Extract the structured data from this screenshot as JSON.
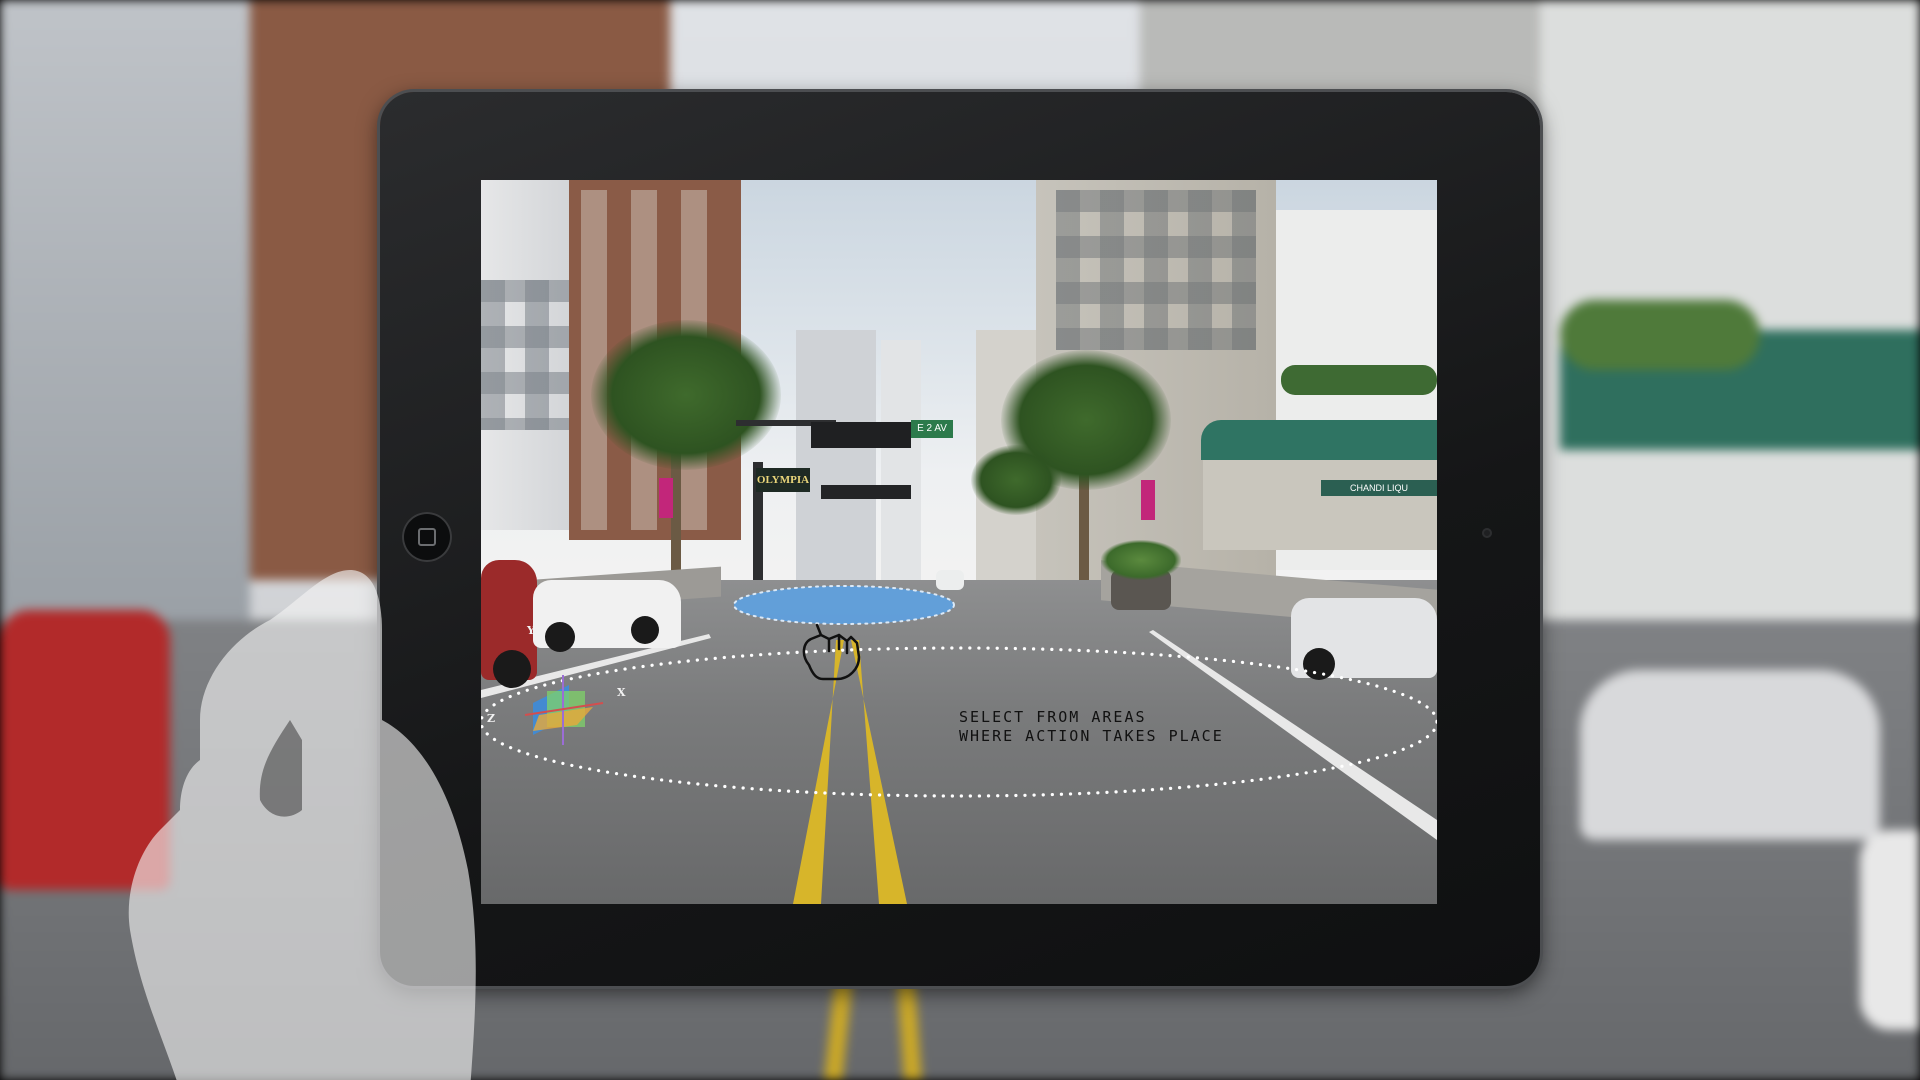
{
  "screen": {
    "instruction_line1": "SELECT FROM AREAS",
    "instruction_line2": "WHERE ACTION TAKES PLACE",
    "axis_labels": {
      "y": "Y",
      "x": "X",
      "z": "Z"
    },
    "target_zone_color": "#5aa2e6",
    "selection_ring_color": "#ffffff"
  },
  "device": {
    "bezel_color": "#151617",
    "home_button_icon": "home-square-icon"
  },
  "icons": {
    "gesture": "tap-hand-icon",
    "axis_gizmo": "3d-axis-gizmo-icon"
  },
  "scene_signs": {
    "theatre_marquee": "OLYMPIA",
    "street_sign": "E 2 AV",
    "store_sign": "CHANDI LIQU"
  }
}
